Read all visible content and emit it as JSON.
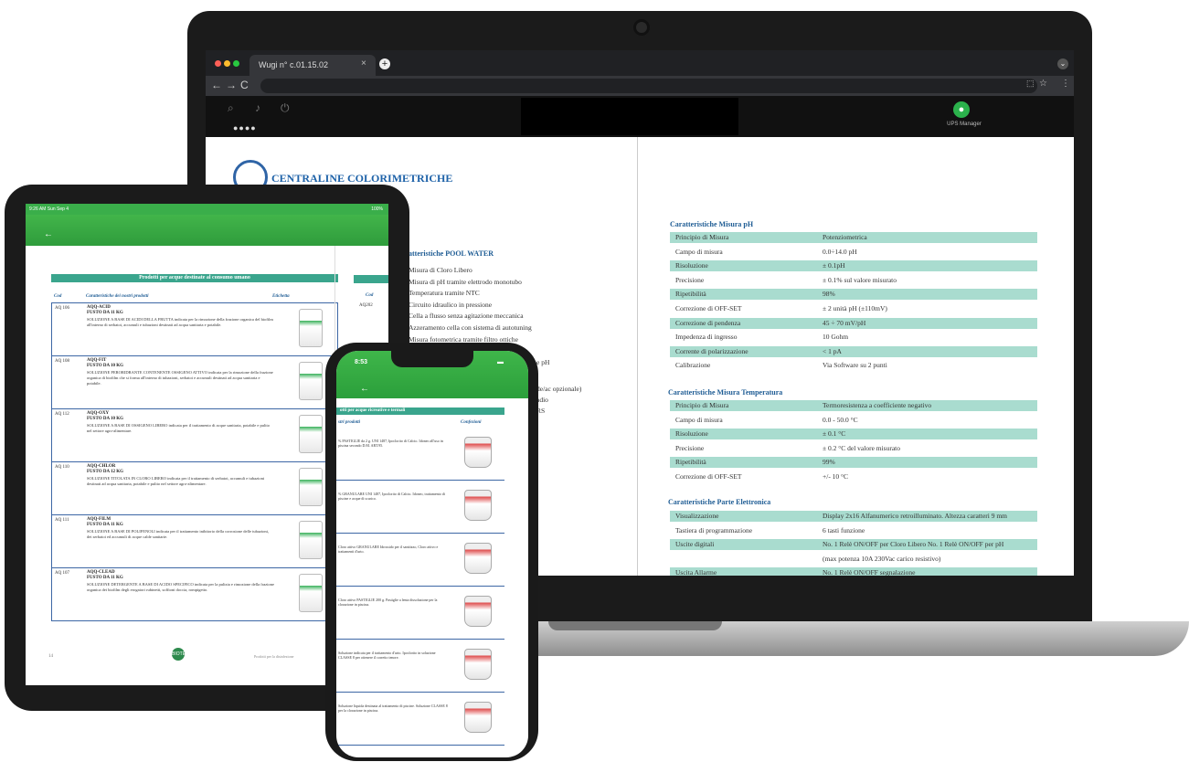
{
  "browser": {
    "tab_title": "Wugi n° c.01.15.02",
    "tab_close": "×",
    "new_tab": "+",
    "url": "",
    "nav": {
      "back": "←",
      "forward": "→",
      "reload": "C"
    }
  },
  "app": {
    "pager": "●●●●",
    "user_name": "UPS Manager",
    "accent_color": "#2bb24c"
  },
  "document": {
    "title": "CENTRALINE COLORIMETRICHE",
    "pool_section_title": "atteristiche POOL WATER",
    "pool_features": [
      "Misura di Cloro Libero",
      "Misura di pH tramite elettrodo monotubo",
      "Temperatura tramite NTC",
      "Circuito idraulico in pressione",
      "Cella a flusso senza agitazione meccanica",
      "Azzeramento cella con sistema di autotuning",
      "Misura fotometrica tramite filtro ottiche"
    ],
    "partial_right": [
      "e pH",
      "de/ac opzionale)",
      "adio",
      "RS"
    ],
    "ph_section_title": "Caratteristiche Misura pH",
    "ph_rows": [
      {
        "label": "Principio di Misura",
        "value": "Potenziometrica"
      },
      {
        "label": "Campo di misura",
        "value": "0.0÷14.0 pH"
      },
      {
        "label": "Risoluzione",
        "value": "± 0.1pH"
      },
      {
        "label": "Precisione",
        "value": "± 0.1% sul valore misurato"
      },
      {
        "label": "Ripetibilità",
        "value": "98%"
      },
      {
        "label": "Correzione di OFF-SET",
        "value": "± 2 unità pH (±110mV)"
      },
      {
        "label": "Correzione di pendenza",
        "value": "45 ÷ 70 mV/pH"
      },
      {
        "label": "Impedenza di ingresso",
        "value": "10 Gohm"
      },
      {
        "label": "Corrente di polarizzazione",
        "value": "< 1 pA"
      },
      {
        "label": "Calibrazione",
        "value": "Via Software su 2 punti"
      }
    ],
    "temp_section_title": "Caratteristiche Misura Temperatura",
    "temp_rows": [
      {
        "label": "Principio di Misura",
        "value": "Termoresistenza a coefficiente negativo"
      },
      {
        "label": "Campo di misura",
        "value": "0.0 - 50.0 °C"
      },
      {
        "label": "Risoluzione",
        "value": "± 0.1 °C"
      },
      {
        "label": "Precisione",
        "value": "± 0.2 °C del valore misurato"
      },
      {
        "label": "Ripetibilità",
        "value": "99%"
      },
      {
        "label": "Correzione di OFF-SET",
        "value": "+/- 10 °C"
      }
    ],
    "elec_section_title": "Caratteristiche Parte Elettronica",
    "elec_rows": [
      {
        "label": "Visualizzazione",
        "value": "Display 2x16 Alfanumerico retroilluminato. Altezza caratteri 9 mm"
      },
      {
        "label": "Tastiera di programmazione",
        "value": "6 tasti funzione"
      },
      {
        "label": "Uscite digitali",
        "value": "No. 1 Relè ON/OFF per Cloro Libero No. 1 Relè ON/OFF per pH"
      },
      {
        "label": "",
        "value": "(max potenza 10A 230Vac carico resistivo)"
      },
      {
        "label": "Uscita Allarme",
        "value": "No. 1 Relè ON/OFF segnalazione"
      }
    ]
  },
  "tablet": {
    "status_left": "9:26 AM  Sun Sep 4",
    "status_right": "100%",
    "back": "←",
    "doc_title": "Prodotti per acque destinate al consumo umano",
    "col_code": "Cod",
    "col_desc": "Caratteristiche dei nostri prodotti",
    "col_label": "Etichetta",
    "right_col_code": "Cod",
    "right_code": "AQ202",
    "items": [
      {
        "code": "AQ 106",
        "name": "AQQ-ACID\nFUSTO DA 11 KG",
        "desc": "SOLUZIONE A BASE DI ACIDI DELLA FRUTTA indicata per la rimozione della frazione organica del biofilm all'interno di serbatoi, accumuli e tubazioni destinati ad acqua sanitaria e potabile."
      },
      {
        "code": "AQ 108",
        "name": "AQQ-FIT\nFUSTO DA 10 KG",
        "desc": "SOLUZIONE PERORIDRANTE CONTENENTE OSSIGENO ATTIVO indicata per la rimozione della frazione organica di biofilm che si forma all'interno di tubazioni, serbatoi e accumuli destinati ad acqua sanitaria e potabile."
      },
      {
        "code": "AQ 112",
        "name": "AQQ-OXY\nFUSTO DA 10 KG",
        "desc": "SOLUZIONE A BASE DI OSSIGENO LIBERO indicata per il trattamento di acque sanitaria, potabile e pulito nel settore agro-alimentare."
      },
      {
        "code": "AQ 110",
        "name": "AQQ-CHLOR\nFUSTO DA 12 KG",
        "desc": "SOLUZIONE TITOLATA IN CLORO LIBERO indicata per il trattamento di serbatoi, accumuli e tubazioni destinati ad acqua sanitaria, potabile e pulito nel settore agro-alimentare."
      },
      {
        "code": "AQ 111",
        "name": "AQQ-FILM\nFUSTO DA 11 KG",
        "desc": "SOLUZIONE A BASE DI POLIFENOLI indicata per il trattamento inibitorio della corrosione delle tubazioni, dei serbatoi ed accumuli di acque calde sanitarie."
      },
      {
        "code": "AQ 107",
        "name": "AQQ-CLEAD\nFUSTO DA 11 KG",
        "desc": "SOLUZIONE DETERGENTE A BASE DI ACIDO SPECIFICO indicata per la pulizia e rimozione della frazione organica dei biofilm degli erogatori rubinetti, soffioni doccia, rompigetto."
      }
    ],
    "page_number": "14",
    "brand": "BIOTECH",
    "footer": "Prodotti per la disinfezione"
  },
  "phone": {
    "time": "8:53",
    "back": "←",
    "doc_title": "otti per acque ricreative e termali",
    "col_desc": "stri prodotti",
    "col_label": "Confezioni",
    "items": [
      {
        "desc": "% PASTIGLIE da 2 g. UNI 1487, Ipoclorito di Calcio. Idoneo all'uso in piscina secondo D.M. ART.95."
      },
      {
        "desc": "% GRANULARE UNI 1487, Ipoclorito di Calcio. Idoneo, trattamento di piscine e acque di scarico."
      },
      {
        "desc": "Cloro attivo GRANULARE Idrossido per il sanitizzo, Cloro attivo e trattamenti d'urto."
      },
      {
        "desc": "Cloro attivo PASTIGLIE 200 g. Pastiglie a lenta dissoluzione per la clorazione in piscina."
      },
      {
        "desc": "Soluzione indicata per il trattamento d'urto. Ipoclorito in soluzione CLASSE 8 per ottenere il corretto tenore."
      },
      {
        "desc": "Soluzione liquida destinata al trattamento di piscine. Soluzione CLASSE 8 per la clorazione in piscina."
      }
    ]
  }
}
